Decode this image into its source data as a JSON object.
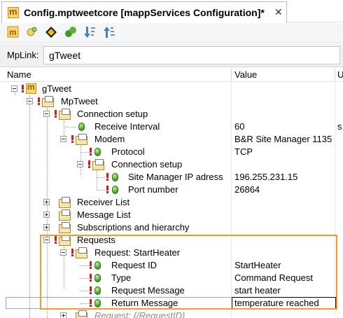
{
  "tab": {
    "title": "Config.mptweetcore [mappServices Configuration]*",
    "close": "✕"
  },
  "toolbar": {
    "buttons": [
      "mapp-icon",
      "new-item-icon",
      "navigate-icon",
      "link-icon",
      "sort-descending-icon",
      "sort-ascending-icon"
    ]
  },
  "mplink": {
    "label": "MpLink:",
    "value": "gTweet"
  },
  "columns": {
    "name": "Name",
    "value": "Value",
    "unit": "U"
  },
  "tree": [
    {
      "label": "gTweet",
      "value": ""
    },
    {
      "label": "MpTweet",
      "value": ""
    },
    {
      "label": "Connection setup",
      "value": ""
    },
    {
      "label": "Receive Interval",
      "value": "60",
      "extra": "s"
    },
    {
      "label": "Modem",
      "value": "B&R Site Manager 1135"
    },
    {
      "label": "Protocol",
      "value": "TCP"
    },
    {
      "label": "Connection setup",
      "value": ""
    },
    {
      "label": "Site Manager IP adress",
      "value": "196.255.231.15"
    },
    {
      "label": "Port number",
      "value": "26864"
    },
    {
      "label": "Receiver List",
      "value": ""
    },
    {
      "label": "Message List",
      "value": ""
    },
    {
      "label": "Subscriptions and hierarchy",
      "value": ""
    },
    {
      "label": "Requests",
      "value": ""
    },
    {
      "label": "Request: StartHeater",
      "value": ""
    },
    {
      "label": "Request ID",
      "value": "StartHeater"
    },
    {
      "label": "Type",
      "value": "Command Request"
    },
    {
      "label": "Request Message",
      "value": "start heater"
    },
    {
      "label": "Return Message",
      "value": "temperature reached"
    },
    {
      "label": "Request: {/RequestID}",
      "value": ""
    }
  ],
  "colors": {
    "highlight": "#f39b2e",
    "warning": "#d41a1a",
    "selection": "#8aa9d9"
  }
}
